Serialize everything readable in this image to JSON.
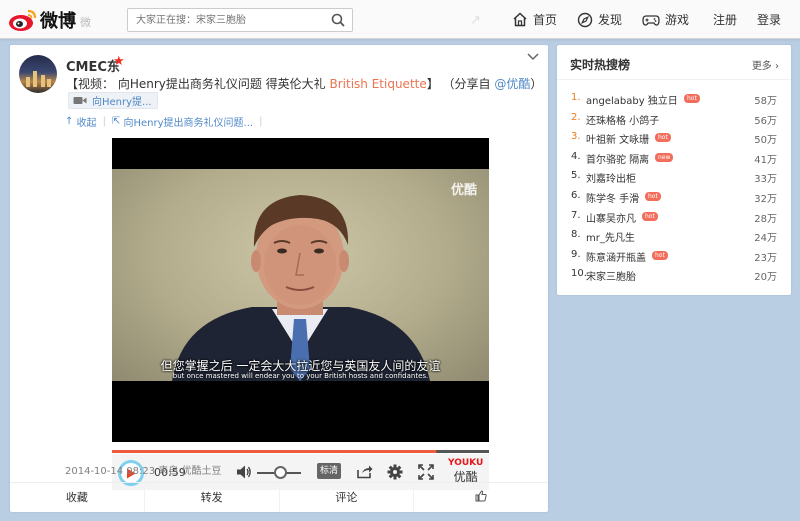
{
  "header": {
    "logo_text": "微博",
    "logo_sub": "微",
    "search_placeholder": "大家正在搜：宋家三胞胎",
    "nav": {
      "home": "首页",
      "discover": "发现",
      "game": "游戏",
      "register": "注册",
      "login": "登录"
    }
  },
  "post": {
    "username": "CMEC东",
    "content_prefix": "【视频： 向Henry提出商务礼仪问题 得英伦大礼 ",
    "content_english": "British Etiquette",
    "content_mid": "】 （分享自 ",
    "content_mention": "@优酷",
    "content_suffix": "）",
    "video_tag": "向Henry提...",
    "collapse_label": "收起",
    "link_label": "向Henry提出商务礼仪问题...",
    "video": {
      "watermark": "优酷",
      "subtitle_cn": "但您掌握之后 一定会大大拉近您与英国友人间的友谊",
      "subtitle_en": "but once mastered will endear you to your British hosts and confidantes.",
      "time": "00:59",
      "hd_label": "标清",
      "youku_en": "YOUKU",
      "youku_cn": "优酷",
      "progress": 0.86
    },
    "meta": "2014-10-14 08:23 来自 优酷土豆",
    "footer": {
      "favorite": "收藏",
      "repost": "转发",
      "comment": "评论"
    }
  },
  "hot": {
    "title": "实时热搜榜",
    "more": "更多",
    "items": [
      {
        "rank": "1.",
        "keyword": "angelababy 独立日",
        "badge": "hot",
        "count": "58万"
      },
      {
        "rank": "2.",
        "keyword": "还珠格格 小鸽子",
        "badge": "",
        "count": "56万"
      },
      {
        "rank": "3.",
        "keyword": "叶祖新 文咏珊",
        "badge": "hot",
        "count": "50万"
      },
      {
        "rank": "4.",
        "keyword": "首尔骆驼 隔离",
        "badge": "new",
        "count": "41万"
      },
      {
        "rank": "5.",
        "keyword": "刘嘉玲出柜",
        "badge": "",
        "count": "33万"
      },
      {
        "rank": "6.",
        "keyword": "陈学冬 手滑",
        "badge": "hot",
        "count": "32万"
      },
      {
        "rank": "7.",
        "keyword": "山寨吴亦凡",
        "badge": "hot",
        "count": "28万"
      },
      {
        "rank": "8.",
        "keyword": "mr_先凡生",
        "badge": "",
        "count": "24万"
      },
      {
        "rank": "9.",
        "keyword": "陈意涵开瓶盖",
        "badge": "hot",
        "count": "23万"
      },
      {
        "rank": "10.",
        "keyword": "宋家三胞胎",
        "badge": "",
        "count": "20万"
      }
    ]
  },
  "colors": {
    "accent_red": "#ef2d20",
    "link_blue": "#4e88c7",
    "rank_orange": "#ef7b1a",
    "badge": "#f26d5b",
    "progress": "#f05a3d"
  }
}
